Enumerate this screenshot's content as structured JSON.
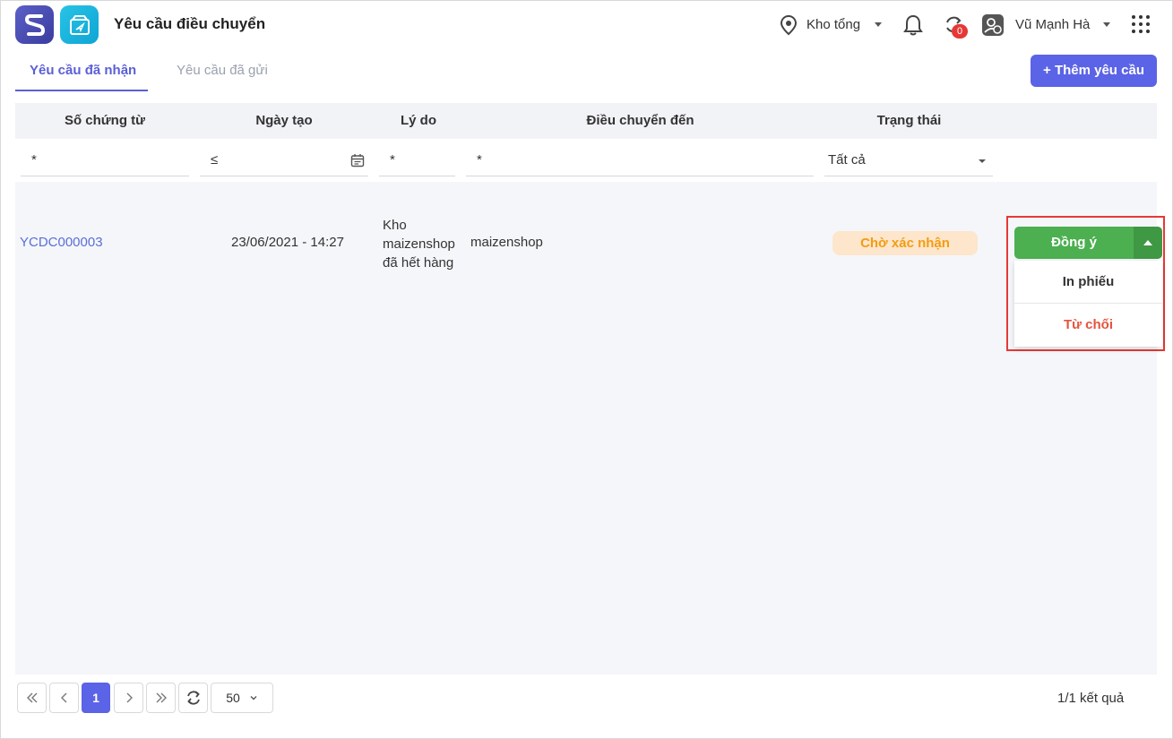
{
  "header": {
    "title": "Yêu cầu điều chuyển",
    "store": "Kho tổng",
    "sync_badge": "0",
    "user_name": "Vũ Mạnh Hà"
  },
  "tabs": [
    {
      "label": "Yêu cầu đã nhận",
      "active": true
    },
    {
      "label": "Yêu cầu đã gửi",
      "active": false
    }
  ],
  "add_button": "+ Thêm yêu cầu",
  "table": {
    "columns": [
      "Số chứng từ",
      "Ngày tạo",
      "Lý do",
      "Điều chuyển đến",
      "Trạng thái"
    ],
    "filters": {
      "doc": "*",
      "date": "≤",
      "reason": "*",
      "destination": "*",
      "status": "Tất cả"
    },
    "rows": [
      {
        "doc": "YCDC000003",
        "date": "23/06/2021 - 14:27",
        "reason_lines": [
          "Kho",
          "maizenshop",
          "đã hết hàng"
        ],
        "destination": "maizenshop",
        "status": "Chờ xác nhận"
      }
    ]
  },
  "actions": {
    "agree": "Đồng ý",
    "print": "In phiếu",
    "reject": "Từ chối"
  },
  "pagination": {
    "current_page": "1",
    "page_size": "50",
    "result": "1/1 kết quả"
  },
  "colors": {
    "accent": "#5b63e6",
    "agree": "#4caf50",
    "reject": "#e5533d",
    "status_bg": "#fde6cc",
    "status_text": "#f39c12"
  }
}
